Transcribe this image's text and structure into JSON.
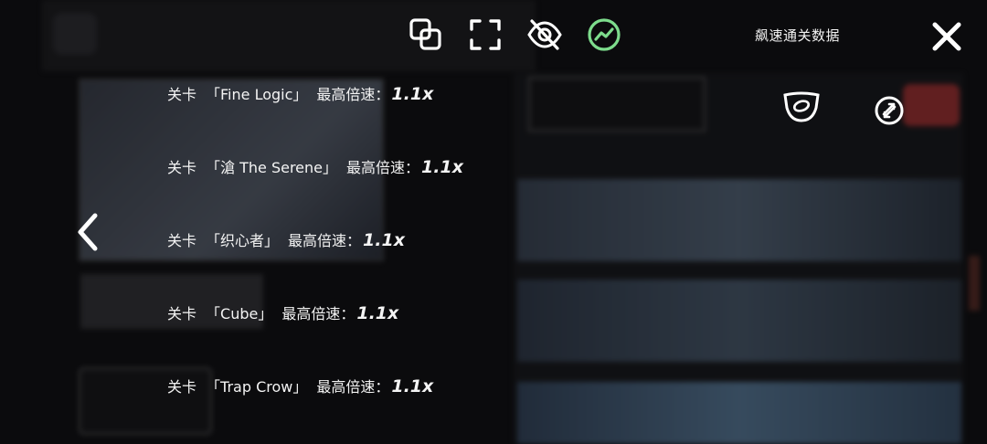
{
  "header": {
    "title": "飙速通关数据"
  },
  "toolbar": {
    "icons": [
      "copy-icon",
      "fullscreen-icon",
      "hide-icon",
      "stats-icon"
    ],
    "accent_color": "#7ddc8c"
  },
  "records": [
    {
      "prefix": "关卡",
      "level": "「Fine Logic」",
      "label": "最高倍速：",
      "value": "1.1x"
    },
    {
      "prefix": "关卡",
      "level": "「滄 The Serene」",
      "label": "最高倍速：",
      "value": "1.1x"
    },
    {
      "prefix": "关卡",
      "level": "「织心者」",
      "label": "最高倍速：",
      "value": "1.1x"
    },
    {
      "prefix": "关卡",
      "level": "「Cube」",
      "label": "最高倍速：",
      "value": "1.1x"
    },
    {
      "prefix": "关卡",
      "level": "「Trap Crow」",
      "label": "最高倍速：",
      "value": "1.1x"
    }
  ]
}
